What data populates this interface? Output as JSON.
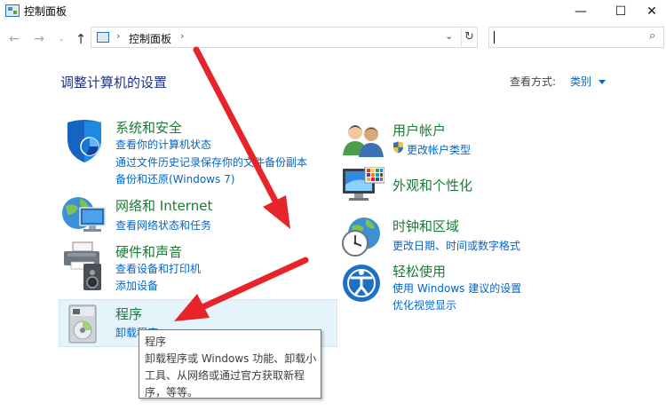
{
  "window": {
    "title": "控制面板",
    "minimize_glyph": "—",
    "maximize_glyph": "☐",
    "close_glyph": "✕"
  },
  "nav": {
    "back_glyph": "←",
    "forward_glyph": "→",
    "history_glyph": "⌄",
    "up_glyph": "↑",
    "address_sep": "›",
    "address": "控制面板",
    "address_sep2": "›",
    "dropdown_glyph": "⌄",
    "refresh_glyph": "↻",
    "search_placeholder": "",
    "search_glyph": "⌕"
  },
  "main": {
    "heading": "调整计算机的设置",
    "view_by_label": "查看方式:",
    "view_by_value": "类别"
  },
  "left_categories": [
    {
      "title": "系统和安全",
      "icon": "shield-icon",
      "links": [
        "查看你的计算机状态",
        "通过文件历史记录保存你的文件备份副本",
        "备份和还原(Windows 7)"
      ]
    },
    {
      "title": "网络和 Internet",
      "icon": "network-globe-icon",
      "links": [
        "查看网络状态和任务"
      ]
    },
    {
      "title": "硬件和声音",
      "icon": "printer-speaker-icon",
      "links": [
        "查看设备和打印机",
        "添加设备"
      ]
    },
    {
      "title": "程序",
      "icon": "programs-icon",
      "links": [
        "卸载程序"
      ]
    }
  ],
  "right_categories": [
    {
      "title": "用户帐户",
      "icon": "users-icon",
      "links": [
        "更改帐户类型"
      ]
    },
    {
      "title": "外观和个性化",
      "icon": "monitor-palette-icon",
      "links": []
    },
    {
      "title": "时钟和区域",
      "icon": "clock-globe-icon",
      "links": [
        "更改日期、时间或数字格式"
      ]
    },
    {
      "title": "轻松使用",
      "icon": "ease-of-access-icon",
      "links": [
        "使用 Windows 建议的设置",
        "优化视觉显示"
      ]
    }
  ],
  "tooltip": {
    "lines": [
      "程序",
      "卸载程序或 Windows 功能、卸载小",
      "工具、从网络或通过官方获取新程",
      "序，等等。"
    ]
  },
  "colors": {
    "category_title": "#1c7a36",
    "link": "#0066cc",
    "heading": "#1e3287",
    "arrow": "#e8242b",
    "highlight": "#e5f3fb"
  }
}
